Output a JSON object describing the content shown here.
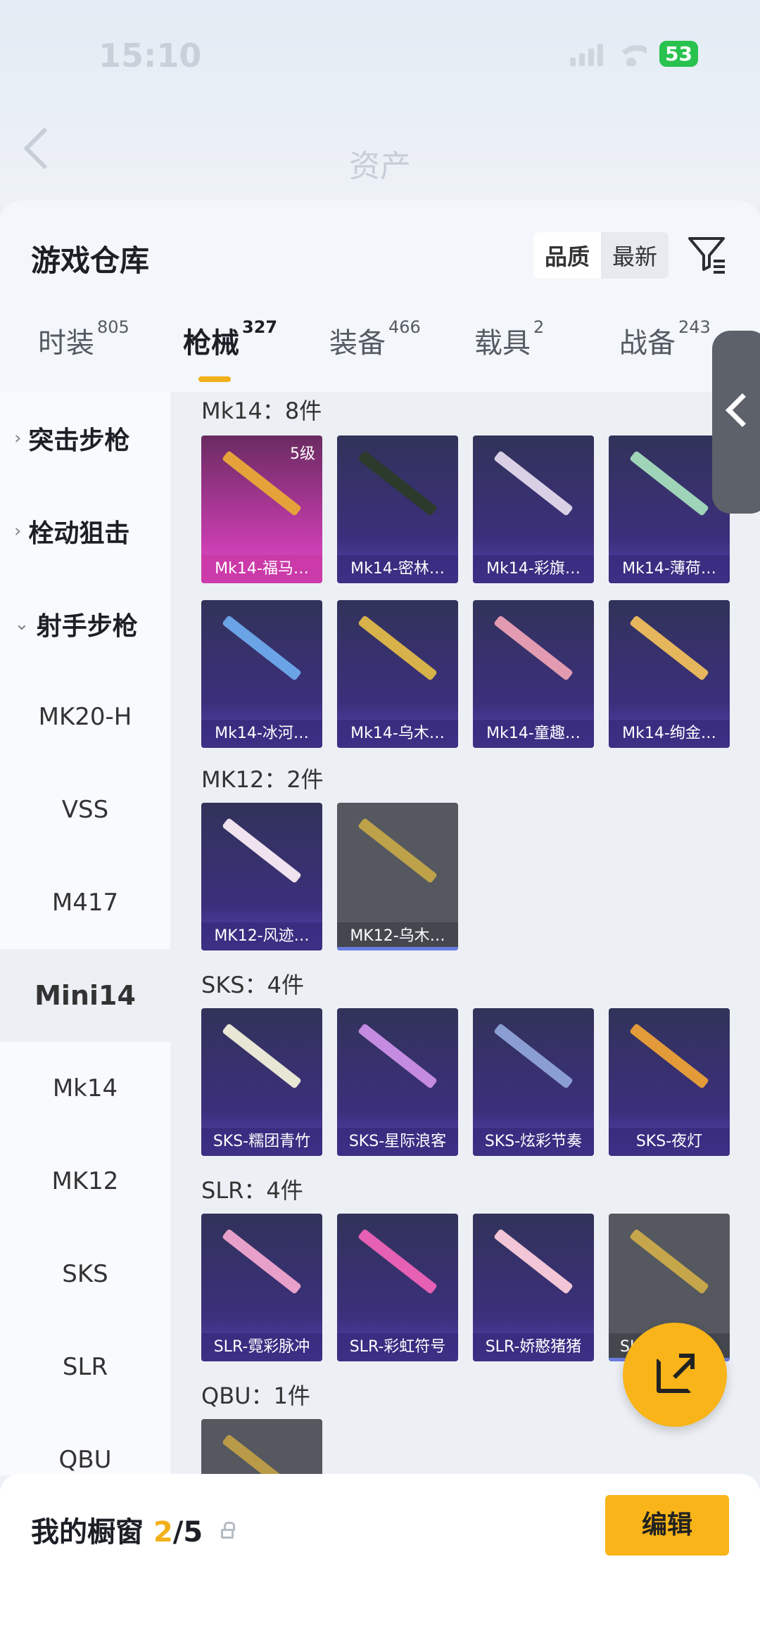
{
  "status": {
    "time": "15:10",
    "battery": "53"
  },
  "nav": {
    "title": "资产"
  },
  "panel": {
    "title": "游戏仓库",
    "sort": [
      "品质",
      "最新"
    ]
  },
  "tabs": [
    {
      "label": "时装",
      "count": "805"
    },
    {
      "label": "枪械",
      "count": "327"
    },
    {
      "label": "装备",
      "count": "466"
    },
    {
      "label": "载具",
      "count": "2"
    },
    {
      "label": "战备",
      "count": "243"
    }
  ],
  "sidebar": {
    "groups": [
      "突击步枪",
      "栓动狙击",
      "射手步枪"
    ],
    "items": [
      "MK20-H",
      "VSS",
      "M417",
      "Mini14",
      "Mk14",
      "MK12",
      "SKS",
      "SLR",
      "QBU"
    ]
  },
  "sections": [
    {
      "title": "Mk14：8件",
      "items": [
        "Mk14-福马…",
        "Mk14-密林…",
        "Mk14-彩旗…",
        "Mk14-薄荷…",
        "Mk14-冰河…",
        "Mk14-乌木…",
        "Mk14-童趣…",
        "Mk14-绚金…"
      ],
      "level": "5级"
    },
    {
      "title": "MK12：2件",
      "items": [
        "MK12-风迹…",
        "MK12-乌木…"
      ]
    },
    {
      "title": "SKS：4件",
      "items": [
        "SKS-糯团青竹",
        "SKS-星际浪客",
        "SKS-炫彩节奏",
        "SKS-夜灯"
      ]
    },
    {
      "title": "SLR：4件",
      "items": [
        "SLR-霓彩脉冲",
        "SLR-彩虹符号",
        "SLR-娇憨猪猪",
        "SL"
      ]
    },
    {
      "title": "QBU：1件",
      "items": []
    }
  ],
  "bottom": {
    "label": "我的橱窗",
    "count": "2",
    "total": "/5",
    "edit": "编辑"
  },
  "colors": {
    "accent": "#f8b418"
  }
}
